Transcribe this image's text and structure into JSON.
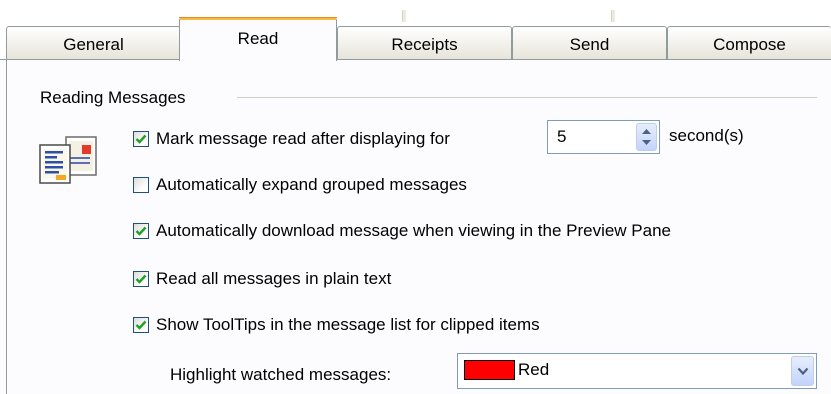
{
  "tabs": [
    {
      "label": "General",
      "active": false
    },
    {
      "label": "Read",
      "active": true
    },
    {
      "label": "Receipts",
      "active": false
    },
    {
      "label": "Send",
      "active": false
    },
    {
      "label": "Compose",
      "active": false
    }
  ],
  "section": {
    "title": "Reading Messages",
    "icon": "message-document-icon"
  },
  "options": [
    {
      "label": "Mark message read after displaying for",
      "checked": true
    },
    {
      "label": "Automatically expand grouped messages",
      "checked": false
    },
    {
      "label": "Automatically download message when viewing in the Preview Pane",
      "checked": true
    },
    {
      "label": "Read all messages in plain text",
      "checked": true
    },
    {
      "label": "Show ToolTips in the message list for clipped items",
      "checked": true
    }
  ],
  "mark_read_delay": {
    "value": "5",
    "unit_label": "second(s)"
  },
  "highlight": {
    "label": "Highlight watched messages:",
    "selected": "Red",
    "swatch_color": "#ff0000"
  },
  "colors": {
    "check": "#21a121",
    "active_tab_accent": "#f7ba43",
    "border": "#919b9c"
  }
}
